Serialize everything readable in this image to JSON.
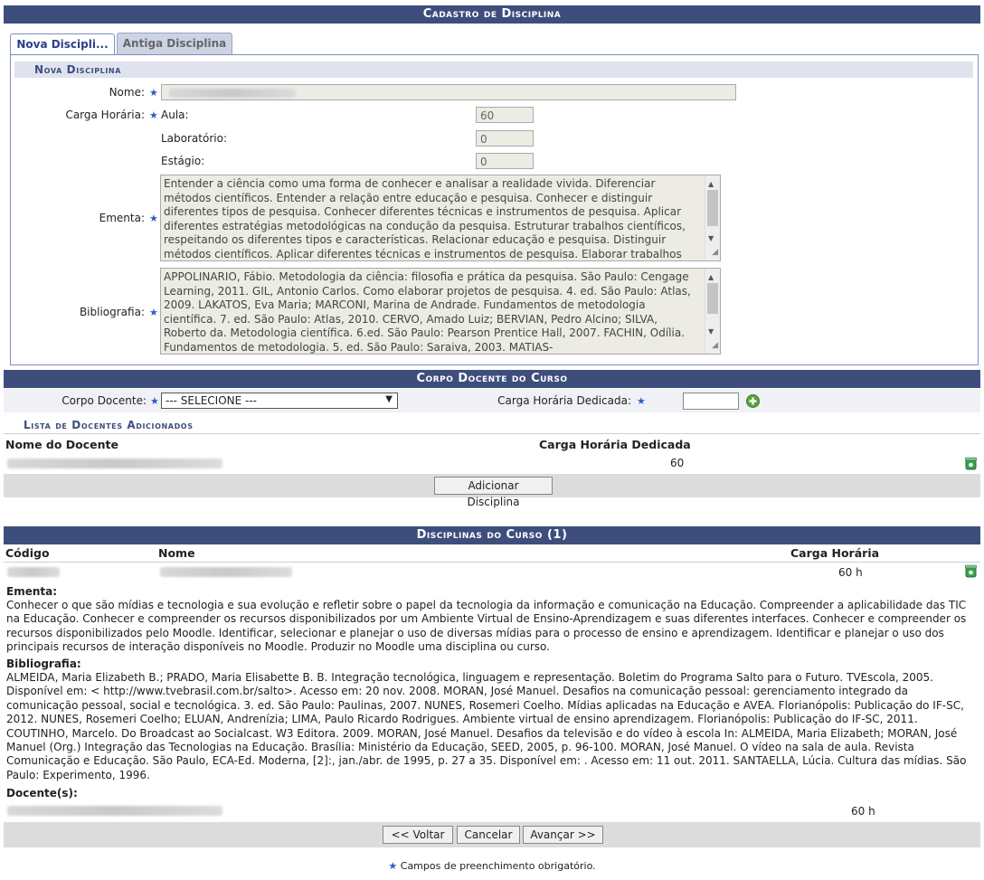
{
  "header": {
    "title": "Cadastro de Disciplina"
  },
  "tabs": [
    {
      "label": "Nova Discipli...",
      "active": true
    },
    {
      "label": "Antiga Disciplina",
      "active": false
    }
  ],
  "form": {
    "section_title": "Nova Disciplina",
    "nome_label": "Nome:",
    "carga_label": "Carga Horária:",
    "aula_label": "Aula:",
    "aula_value": "60",
    "lab_label": "Laboratório:",
    "lab_value": "0",
    "estagio_label": "Estágio:",
    "estagio_value": "0",
    "ementa_label": "Ementa:",
    "ementa_text": "Entender a ciência como uma forma de conhecer e analisar a realidade vivida. Diferenciar métodos científicos. Entender a relação entre educação e pesquisa. Conhecer e distinguir diferentes tipos de pesquisa. Conhecer diferentes técnicas e instrumentos de pesquisa. Aplicar diferentes estratégias metodológicas na condução da pesquisa. Estruturar trabalhos científicos, respeitando os diferentes tipos e características. Relacionar educação e pesquisa. Distinguir métodos científicos. Aplicar diferentes técnicas e instrumentos de pesquisa. Elaborar trabalhos",
    "bibliografia_label": "Bibliografia:",
    "bibliografia_text": "APPOLINARIO, Fábio. Metodologia da ciência: filosofia e prática da pesquisa. São Paulo: Cengage Learning, 2011. GIL, Antonio Carlos. Como elaborar projetos de pesquisa. 4. ed. São Paulo: Atlas, 2009. LAKATOS, Eva Maria; MARCONI, Marina de Andrade. Fundamentos de metodologia científica. 7. ed. São Paulo: Atlas, 2010. CERVO, Amado Luiz; BERVIAN, Pedro Alcino; SILVA, Roberto da. Metodologia científica. 6.ed. São Paulo: Pearson Prentice Hall, 2007. FACHIN, Odília. Fundamentos de metodologia. 5. ed. São Paulo: Saraiva, 2003. MATIAS-",
    "required_star": "★"
  },
  "corpo": {
    "title": "Corpo Docente do Curso",
    "docente_label": "Corpo Docente:",
    "select_value": "--- SELECIONE ---",
    "carga_label": "Carga Horária Dedicada:",
    "lista_title": "Lista de Docentes Adicionados",
    "col_nome": "Nome do Docente",
    "col_carga": "Carga Horária Dedicada",
    "row_carga": "60",
    "add_button": "Adicionar Disciplina"
  },
  "disciplinas": {
    "title": "Disciplinas do Curso (1)",
    "col_codigo": "Código",
    "col_nome": "Nome",
    "col_carga": "Carga Horária",
    "row_carga": "60 h",
    "ementa_label": "Ementa:",
    "ementa_text": "Conhecer o que são mídias e tecnologia e sua evolução e refletir sobre o papel da tecnologia da informação e comunicação na Educação. Compreender a aplicabilidade das TIC na Educação. Conhecer e compreender os recursos disponibilizados por um Ambiente Virtual de Ensino-Aprendizagem e suas diferentes interfaces. Conhecer e compreender os recursos disponibilizados pelo Moodle. Identificar, selecionar e planejar o uso de diversas mídias para o processo de ensino e aprendizagem. Identificar e planejar o uso dos principais recursos de interação disponíveis no Moodle. Produzir no Moodle uma disciplina ou curso.",
    "biblio_label": "Bibliografia:",
    "biblio_text": "ALMEIDA, Maria Elizabeth B.; PRADO, Maria Elisabette B. B. Integração tecnológica, linguagem e representação. Boletim do Programa Salto para o Futuro. TVEscola, 2005. Disponível em: < http://www.tvebrasil.com.br/salto>. Acesso em: 20 nov. 2008. MORAN, José Manuel. Desafios na comunicação pessoal: gerenciamento integrado da comunicação pessoal, social e tecnológica. 3. ed. São Paulo: Paulinas, 2007. NUNES, Rosemeri Coelho. Mídias aplicadas na Educação e AVEA. Florianópolis: Publicação do IF-SC, 2012. NUNES, Rosemeri Coelho; ELUAN, Andrenízia; LIMA, Paulo Ricardo Rodrigues. Ambiente virtual de ensino aprendizagem. Florianópolis: Publicação do IF-SC, 2011. COUTINHO, Marcelo. Do Broadcast ao Socialcast. W3 Editora. 2009. MORAN, José Manuel. Desafios da televisão e do vídeo à escola In: ALMEIDA, Maria Elizabeth; MORAN, José Manuel (Org.) Integração das Tecnologias na Educação. Brasília: Ministério da Educação, SEED, 2005, p. 96-100. MORAN, José Manuel. O vídeo na sala de aula. Revista Comunicação e Educação. São Paulo, ECA-Ed. Moderna, [2]:, jan./abr. de 1995, p. 27 a 35. Disponível em: . Acesso em: 11 out. 2011. SANTAELLA, Lúcia. Cultura das mídias. São Paulo: Experimento, 1996.",
    "docentes_label": "Docente(s):",
    "docente_carga": "60 h"
  },
  "nav": {
    "voltar": "<< Voltar",
    "cancelar": "Cancelar",
    "avancar": "Avançar >>"
  },
  "footer": {
    "note": "Campos de preenchimento obrigatório.",
    "star": "★"
  },
  "colors": {
    "header_bg": "#3e4e7c",
    "subhead_bg": "#dfe3ee",
    "required_star": "#2c5bc9"
  }
}
